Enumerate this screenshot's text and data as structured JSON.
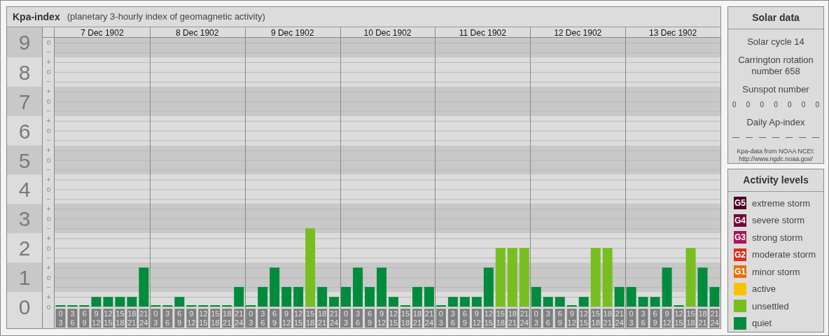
{
  "main": {
    "title": "Kpa-index",
    "subtitle": "(planetary 3-hourly index of geomagnetic activity)",
    "scale_marks": [
      "o",
      "−",
      "+",
      "o",
      "−",
      "+",
      "o",
      "−",
      "+",
      "o",
      "−",
      "+",
      "o",
      "−",
      "+",
      "o",
      "−",
      "+",
      "o",
      "−",
      "+",
      "o",
      "−",
      "+",
      "o",
      "−",
      "+",
      "o"
    ],
    "days": [
      {
        "date": "7 Dec 1902",
        "slots": [
          [
            "0",
            "3"
          ],
          [
            "3",
            "6"
          ],
          [
            "6",
            "9"
          ],
          [
            "9",
            "12"
          ],
          [
            "12",
            "15"
          ],
          [
            "15",
            "18"
          ],
          [
            "18",
            "21"
          ],
          [
            "21",
            "24"
          ]
        ]
      },
      {
        "date": "8 Dec 1902",
        "slots": [
          [
            "0",
            "3"
          ],
          [
            "3",
            "6"
          ],
          [
            "6",
            "9"
          ],
          [
            "9",
            "12"
          ],
          [
            "12",
            "15"
          ],
          [
            "15",
            "18"
          ],
          [
            "18",
            "21"
          ],
          [
            "21",
            "24"
          ]
        ]
      },
      {
        "date": "9 Dec 1902",
        "slots": [
          [
            "0",
            "3"
          ],
          [
            "3",
            "6"
          ],
          [
            "6",
            "9"
          ],
          [
            "9",
            "12"
          ],
          [
            "12",
            "15"
          ],
          [
            "15",
            "18"
          ],
          [
            "18",
            "21"
          ],
          [
            "21",
            "24"
          ]
        ]
      },
      {
        "date": "10 Dec 1902",
        "slots": [
          [
            "0",
            "3"
          ],
          [
            "3",
            "6"
          ],
          [
            "6",
            "9"
          ],
          [
            "9",
            "12"
          ],
          [
            "12",
            "15"
          ],
          [
            "15",
            "18"
          ],
          [
            "18",
            "21"
          ],
          [
            "21",
            "24"
          ]
        ]
      },
      {
        "date": "11 Dec 1902",
        "slots": [
          [
            "0",
            "3"
          ],
          [
            "3",
            "6"
          ],
          [
            "6",
            "9"
          ],
          [
            "9",
            "12"
          ],
          [
            "12",
            "15"
          ],
          [
            "15",
            "18"
          ],
          [
            "18",
            "21"
          ],
          [
            "21",
            "24"
          ]
        ]
      },
      {
        "date": "12 Dec 1902",
        "slots": [
          [
            "0",
            "3"
          ],
          [
            "3",
            "6"
          ],
          [
            "6",
            "9"
          ],
          [
            "9",
            "12"
          ],
          [
            "12",
            "15"
          ],
          [
            "15",
            "18"
          ],
          [
            "18",
            "21"
          ],
          [
            "21",
            "24"
          ]
        ]
      },
      {
        "date": "13 Dec 1902",
        "slots": [
          [
            "0",
            "3"
          ],
          [
            "3",
            "6"
          ],
          [
            "6",
            "9"
          ],
          [
            "9",
            "12"
          ],
          [
            "12",
            "15"
          ],
          [
            "15",
            "18"
          ],
          [
            "18",
            "21"
          ],
          [
            "21",
            "24"
          ]
        ]
      }
    ],
    "chart_data": {
      "type": "bar",
      "grid": true,
      "ylim": [
        0,
        9
      ],
      "yticks": [
        9,
        8,
        7,
        6,
        5,
        4,
        3,
        2,
        1,
        0
      ],
      "series": [
        {
          "color": "#008c3c",
          "values": [
            0,
            0,
            0,
            0.33,
            0.33,
            0.33,
            0.33,
            1.33,
            0,
            0,
            0.33,
            0,
            0,
            0,
            0,
            0.67,
            0,
            0.67,
            1.33,
            0.67,
            0.67,
            null,
            0.67,
            0.33,
            0.67,
            1.33,
            0.67,
            1.33,
            0.33,
            0,
            0.67,
            0.67,
            0,
            0.33,
            0.33,
            0.33,
            1.33,
            null,
            null,
            null,
            0.67,
            0.33,
            0.33,
            0,
            0.33,
            null,
            null,
            0.67,
            0.67,
            0.33,
            0.33,
            1.33,
            0,
            null,
            1.33,
            0.67
          ]
        },
        {
          "color": "#78be21",
          "values": [
            null,
            null,
            null,
            null,
            null,
            null,
            null,
            null,
            null,
            null,
            null,
            null,
            null,
            null,
            null,
            null,
            null,
            null,
            null,
            null,
            null,
            2.67,
            null,
            null,
            null,
            null,
            null,
            null,
            null,
            null,
            null,
            null,
            null,
            null,
            null,
            null,
            null,
            2,
            2,
            2,
            null,
            null,
            null,
            null,
            null,
            2,
            2,
            null,
            null,
            null,
            null,
            null,
            null,
            2,
            null,
            null
          ]
        }
      ]
    }
  },
  "solar": {
    "title": "Solar data",
    "cycle": "Solar cycle 14",
    "rotation": "Carrington rotation number 658",
    "sunspot_label": "Sunspot number",
    "sunspots": [
      "0",
      "0",
      "0",
      "0",
      "0",
      "0",
      "0"
    ],
    "ap_label": "Daily Ap-index",
    "ap": [
      "—",
      "—",
      "—",
      "—",
      "—",
      "—",
      "—"
    ],
    "source": "Kpa-data from NOAA NCEI:",
    "source_url": "http://www.ngdc.noaa.gov/"
  },
  "legend": {
    "title": "Activity levels",
    "items": [
      {
        "code": "G5",
        "label": "extreme storm",
        "color": "#4b0026"
      },
      {
        "code": "G4",
        "label": "severe storm",
        "color": "#6e0a3c"
      },
      {
        "code": "G3",
        "label": "strong storm",
        "color": "#a8155e"
      },
      {
        "code": "G2",
        "label": "moderate storm",
        "color": "#d6321c"
      },
      {
        "code": "G1",
        "label": "minor storm",
        "color": "#e8700e"
      },
      {
        "label": "active",
        "color": "#f9c300"
      },
      {
        "label": "unsettled",
        "color": "#78be21"
      },
      {
        "label": "quiet",
        "color": "#008c3c"
      }
    ]
  }
}
